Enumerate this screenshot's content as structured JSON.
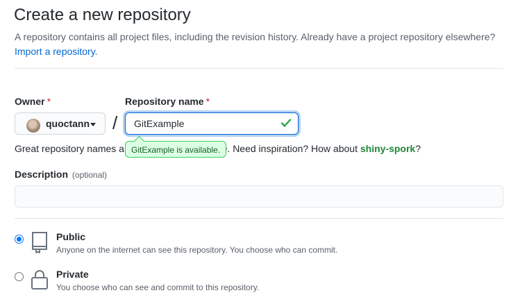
{
  "page": {
    "title": "Create a new repository",
    "subtitle": "A repository contains all project files, including the revision history. Already have a project repository elsewhere?",
    "import_link": "Import a repository",
    "import_suffix": "."
  },
  "owner": {
    "label": "Owner",
    "required_mark": "*",
    "value": "quoctann"
  },
  "separator": "/",
  "repo_name": {
    "label": "Repository name",
    "required_mark": "*",
    "value": "GitExample",
    "status_icon": "check-icon"
  },
  "availability_tooltip": "GitExample is available.",
  "hint": {
    "prefix": "Great repository names ar",
    "middle": "e. Need inspiration? How about ",
    "suggestion": "shiny-spork",
    "suffix": "?"
  },
  "description": {
    "label": "Description",
    "optional": "(optional)",
    "value": ""
  },
  "visibility": [
    {
      "title": "Public",
      "description": "Anyone on the internet can see this repository. You choose who can commit.",
      "selected": true,
      "icon": "repo-icon"
    },
    {
      "title": "Private",
      "description": "You choose who can see and commit to this repository.",
      "selected": false,
      "icon": "lock-icon"
    }
  ],
  "colors": {
    "link": "#0366d6",
    "success": "#28a745",
    "required": "#cb2431",
    "radio_accent": "#0075ff"
  }
}
